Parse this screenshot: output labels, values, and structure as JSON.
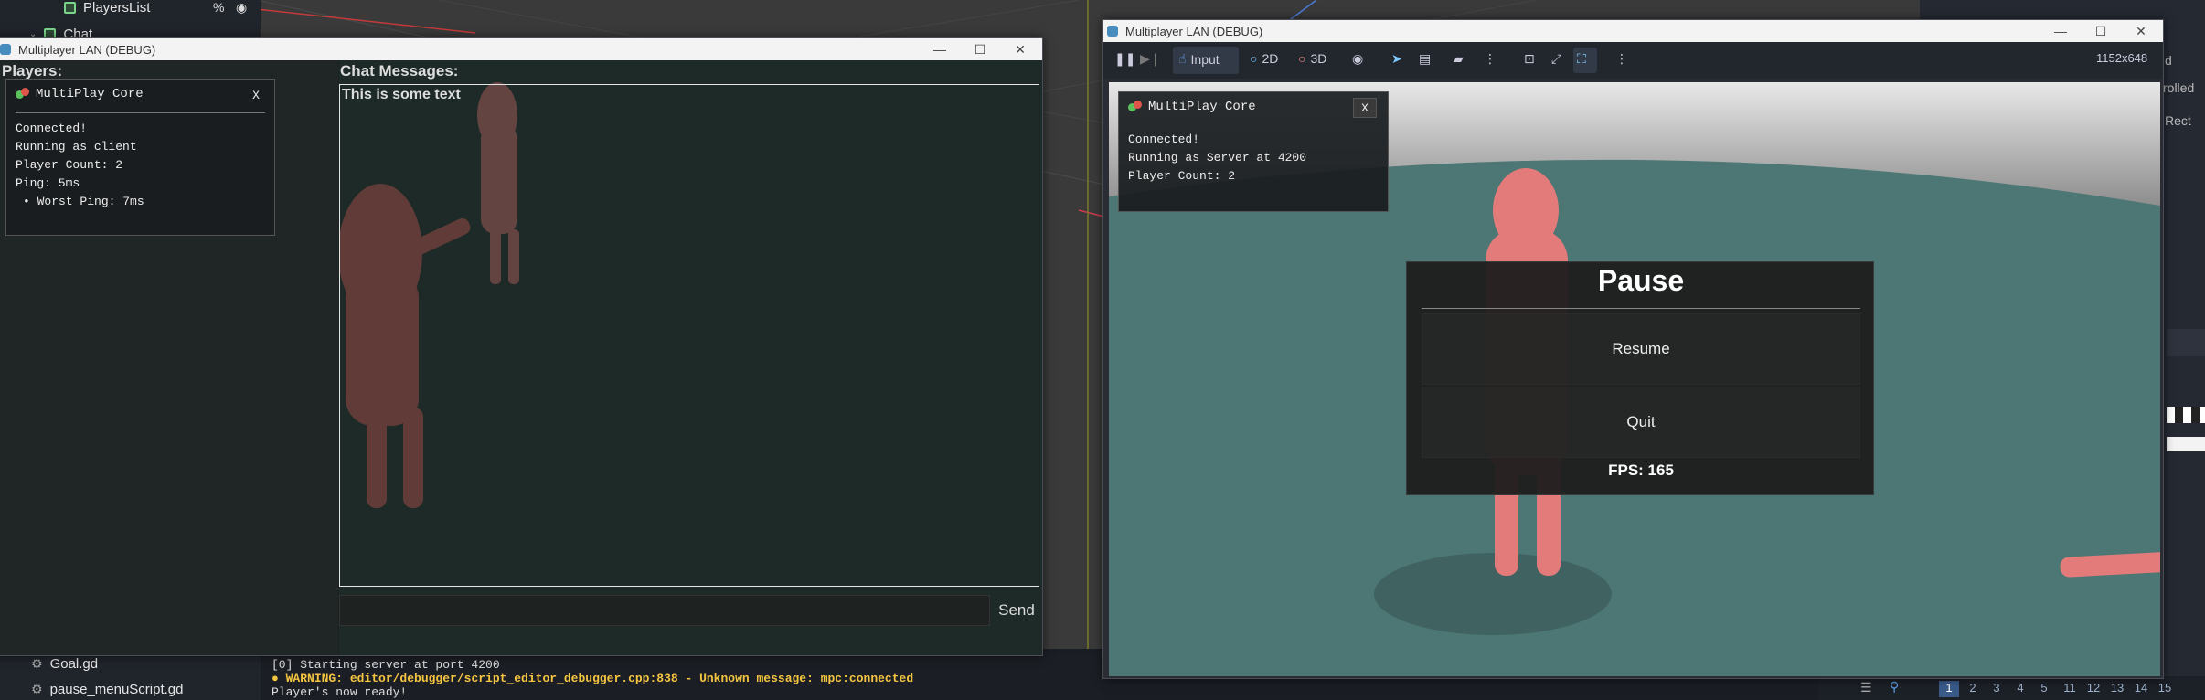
{
  "scene_tree": {
    "items": [
      {
        "label": "PlayersList",
        "icon": "control-node-icon"
      },
      {
        "label": "Chat",
        "icon": "control-node-icon"
      }
    ]
  },
  "filesystem": {
    "items": [
      {
        "label": "Goal.gd",
        "icon": "gear-icon"
      },
      {
        "label": "pause_menuScript.gd",
        "icon": "gear-icon"
      }
    ]
  },
  "output": {
    "lines": [
      "[0] Starting server at port 4200",
      "WARNING: editor/debugger/script_editor_debugger.cpp:838 - Unknown message: mpc:connected",
      "Player's now ready!"
    ],
    "warning_color": "#f5c542"
  },
  "right_dock": {
    "labels": [
      "d",
      "rolled",
      "Rect"
    ]
  },
  "layers": [
    "1",
    "2",
    "3",
    "4",
    "5",
    "11",
    "12",
    "13",
    "14",
    "15"
  ],
  "game_client": {
    "title": "Multiplayer LAN (DEBUG)",
    "players_label": "Players:",
    "chat_label": "Chat Messages:",
    "chat_messages": [
      "This is some text"
    ],
    "send_label": "Send",
    "mp_core": {
      "title": "MultiPlay Core",
      "close": "X",
      "lines": [
        "Connected!",
        "Running as client",
        "Player Count: 2",
        "Ping: 5ms",
        "• Worst Ping: 7ms"
      ]
    }
  },
  "game_server": {
    "title": "Multiplayer LAN (DEBUG)",
    "toolbar": {
      "input_label": "Input",
      "btn_2d": "2D",
      "btn_3d": "3D",
      "resolution": "1152x648"
    },
    "mp_core": {
      "title": "MultiPlay Core",
      "close": "X",
      "lines": [
        "Connected!",
        "Running as Server at 4200",
        "Player Count: 2"
      ]
    },
    "pause_menu": {
      "title": "Pause",
      "resume": "Resume",
      "quit": "Quit",
      "fps": "FPS: 165"
    }
  }
}
